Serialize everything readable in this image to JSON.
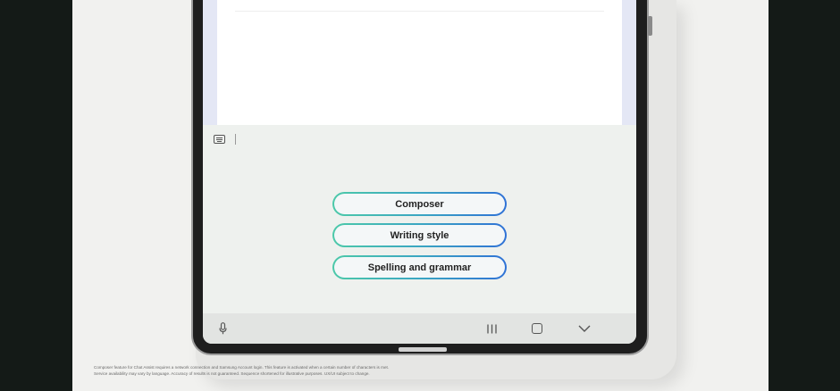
{
  "assist_menu": {
    "composer_label": "Composer",
    "writing_style_label": "Writing style",
    "spelling_grammar_label": "Spelling and grammar"
  },
  "icons": {
    "keyboard": "keyboard-icon",
    "microphone": "microphone-icon",
    "recents": "recents-icon",
    "home": "home-icon",
    "back": "back-icon"
  },
  "colors": {
    "pill_gradient_start": "#4cc9a9",
    "pill_gradient_end": "#2f72d6"
  },
  "disclaimer": {
    "line1": "Composer feature for Chat Assist requires a network connection and Samsung Account login. This feature is activated when a certain number of characters is met.",
    "line2": "Service availability may vary by language. Accuracy of results is not guaranteed. Sequence shortened for illustrative purposes. UX/UI subject to change."
  }
}
